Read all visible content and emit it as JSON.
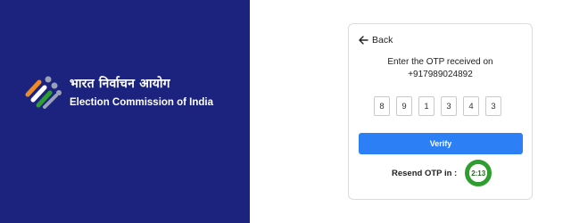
{
  "brand": {
    "hindi": "भारत निर्वाचन आयोग",
    "english": "Election Commission of India",
    "logo_icon": "eci-logo-icon"
  },
  "card": {
    "back_label": "Back",
    "back_icon": "arrow-left-icon",
    "otp_message_line1": "Enter the OTP received on",
    "otp_phone": "+917989024892",
    "otp_digits": [
      "8",
      "9",
      "1",
      "3",
      "4",
      "3"
    ],
    "verify_label": "Verify",
    "resend_label": "Resend OTP in :",
    "timer_value": "2:13"
  },
  "colors": {
    "panel_bg": "#1b237f",
    "verify_bg": "#2d7ff5",
    "timer_ring": "#2e9e2e"
  }
}
